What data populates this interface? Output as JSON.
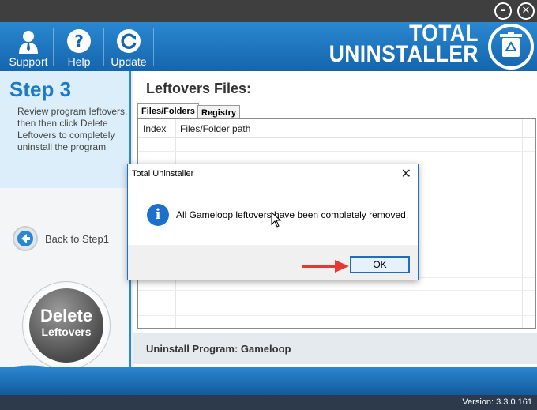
{
  "window": {
    "minimize_icon": "minimize-icon",
    "close_icon": "close-icon"
  },
  "toolbar": {
    "support_label": "Support",
    "help_label": "Help",
    "update_label": "Update"
  },
  "brand": {
    "line1": "TOTAL",
    "line2": "UNINSTALLER"
  },
  "sidebar": {
    "step_title": "Step 3",
    "step_description": "Review program leftovers, then then click Delete Leftovers to completely uninstall the program",
    "back_label": "Back to Step1",
    "delete_line1": "Delete",
    "delete_line2": "Leftovers"
  },
  "main": {
    "title": "Leftovers Files:",
    "tabs": [
      {
        "label": "Files/Folders",
        "active": true
      },
      {
        "label": "Registry",
        "active": false
      }
    ],
    "columns": [
      "Index",
      "Files/Folder path"
    ],
    "program_label": "Uninstall Program: Gameloop"
  },
  "dialog": {
    "title": "Total Uninstaller",
    "message": "All Gameloop leftovers have been completely removed.",
    "ok_label": "OK"
  },
  "status": {
    "version": "Version: 3.3.0.161"
  },
  "colors": {
    "accent": "#1f7ac4",
    "toolbar": "#1a72bd",
    "arrow": "#e53935"
  }
}
